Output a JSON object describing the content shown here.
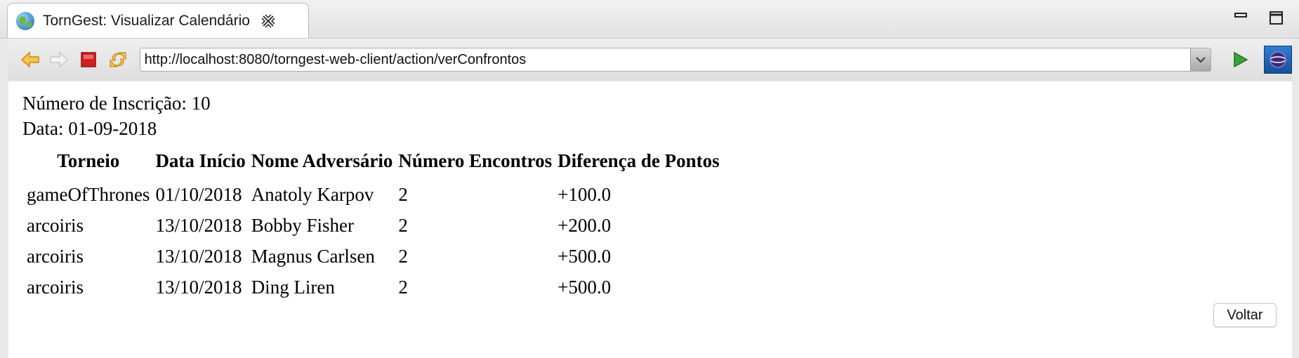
{
  "window": {
    "tab_title": "TornGest: Visualizar Calendário"
  },
  "toolbar": {
    "url": "http://localhost:8080/torngest-web-client/action/verConfrontos",
    "icons": [
      "back-arrow-icon",
      "forward-arrow-icon",
      "stop-icon",
      "refresh-icon",
      "go-icon",
      "eclipse-icon"
    ]
  },
  "page": {
    "inscricao": "Número de Inscrição: 10",
    "data": "Data: 01-09-2018",
    "table": {
      "headers": [
        "Torneio",
        "Data Início",
        "Nome Adversário",
        "Número Encontros",
        "Diferença de Pontos"
      ],
      "rows": [
        [
          "gameOfThrones",
          "01/10/2018",
          "Anatoly Karpov",
          "2",
          "+100.0"
        ],
        [
          "arcoiris",
          "13/10/2018",
          "Bobby Fisher",
          "2",
          "+200.0"
        ],
        [
          "arcoiris",
          "13/10/2018",
          "Magnus Carlsen",
          "2",
          "+500.0"
        ],
        [
          "arcoiris",
          "13/10/2018",
          "Ding Liren",
          "2",
          "+500.0"
        ]
      ]
    },
    "voltar_label": "Voltar"
  },
  "colors": {
    "accent_orange": "#f0a020",
    "stop_red": "#d42020",
    "go_green": "#3aa63a"
  }
}
